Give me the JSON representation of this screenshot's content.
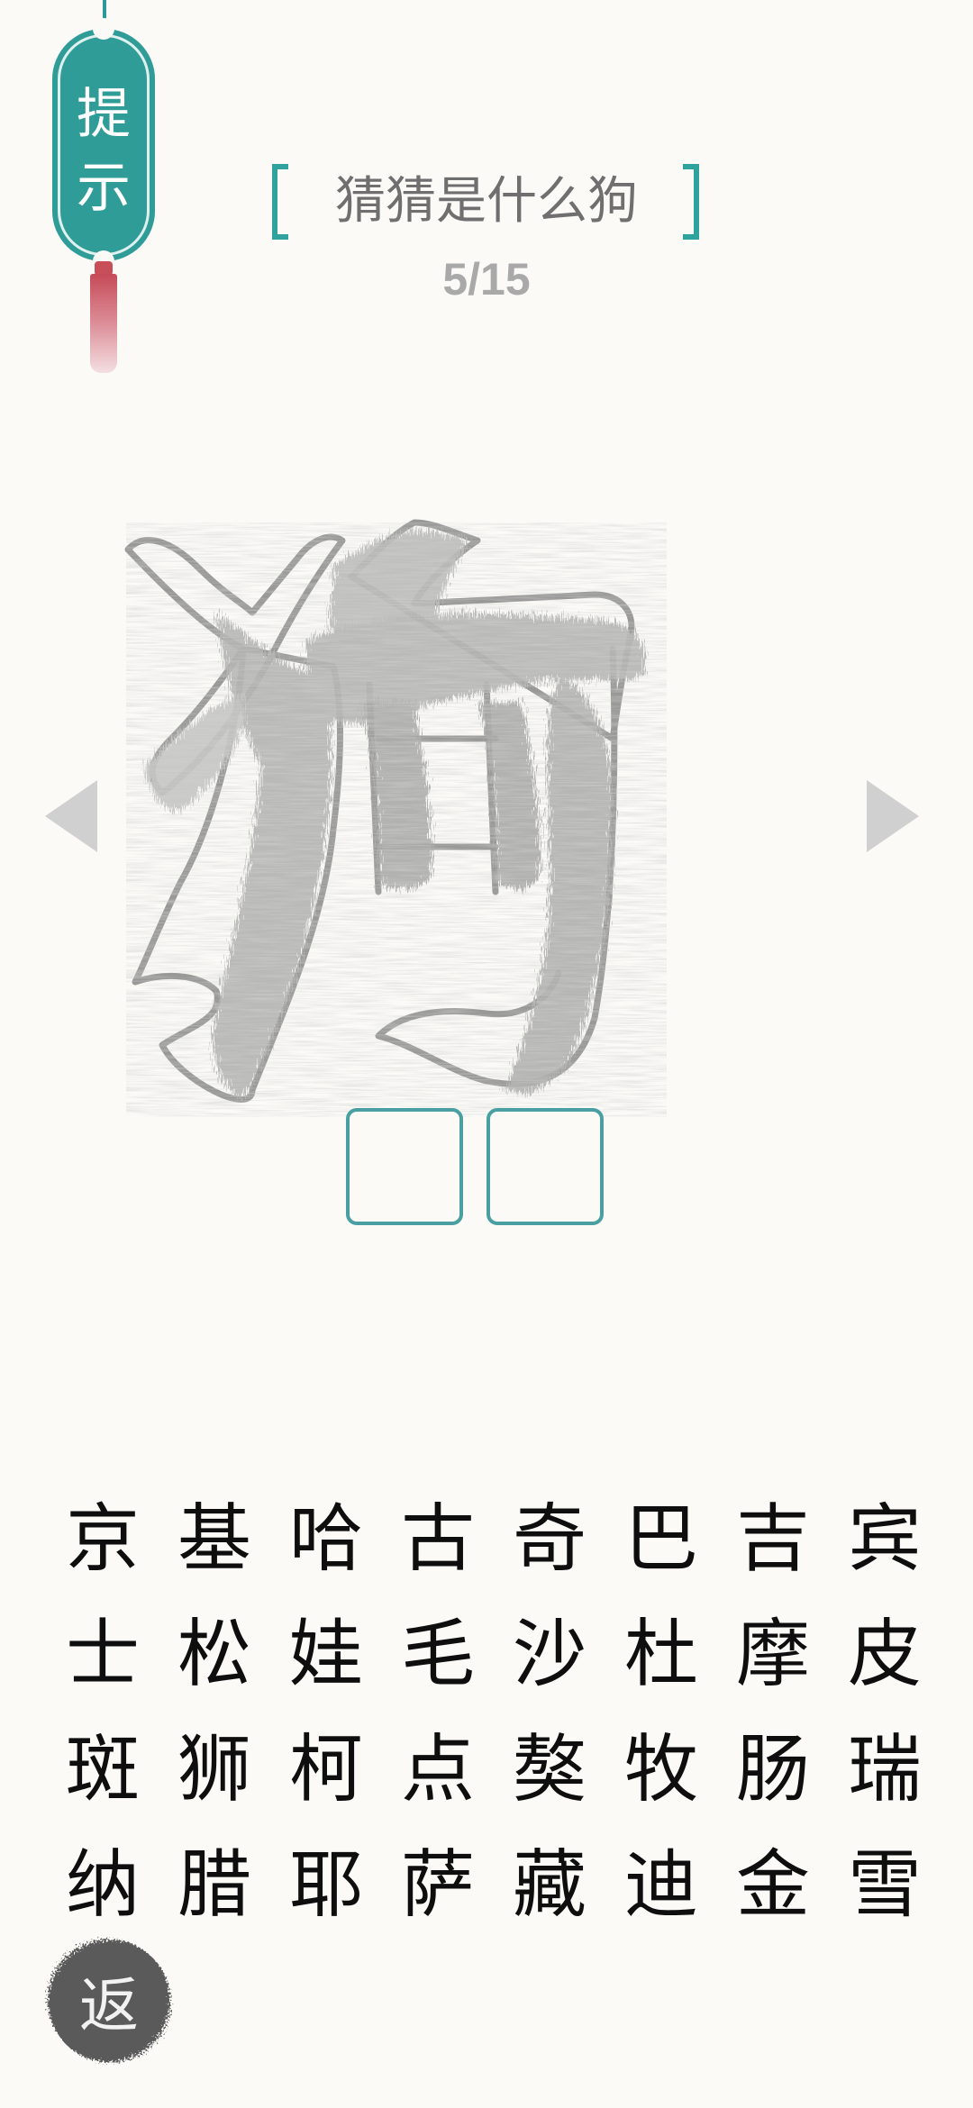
{
  "hint": {
    "label": "提\n示"
  },
  "title": "猜猜是什么狗",
  "progress": "5/15",
  "puzzle": {
    "character": "狗",
    "icon": "fur-textured-character"
  },
  "navigation": {
    "prev_icon": "triangle-left-icon",
    "next_icon": "triangle-right-icon"
  },
  "answer": {
    "slots": [
      "",
      ""
    ]
  },
  "choices": [
    [
      "京",
      "基",
      "哈",
      "古",
      "奇",
      "巴",
      "吉",
      "宾"
    ],
    [
      "士",
      "松",
      "娃",
      "毛",
      "沙",
      "杜",
      "摩",
      "皮"
    ],
    [
      "斑",
      "狮",
      "柯",
      "点",
      "獒",
      "牧",
      "肠",
      "瑞"
    ],
    [
      "纳",
      "腊",
      "耶",
      "萨",
      "藏",
      "迪",
      "金",
      "雪"
    ]
  ],
  "back": {
    "label": "返"
  },
  "colors": {
    "accent": "#2f9c98",
    "tassel": "#c84f5a",
    "text_muted": "#a9a9a9"
  }
}
